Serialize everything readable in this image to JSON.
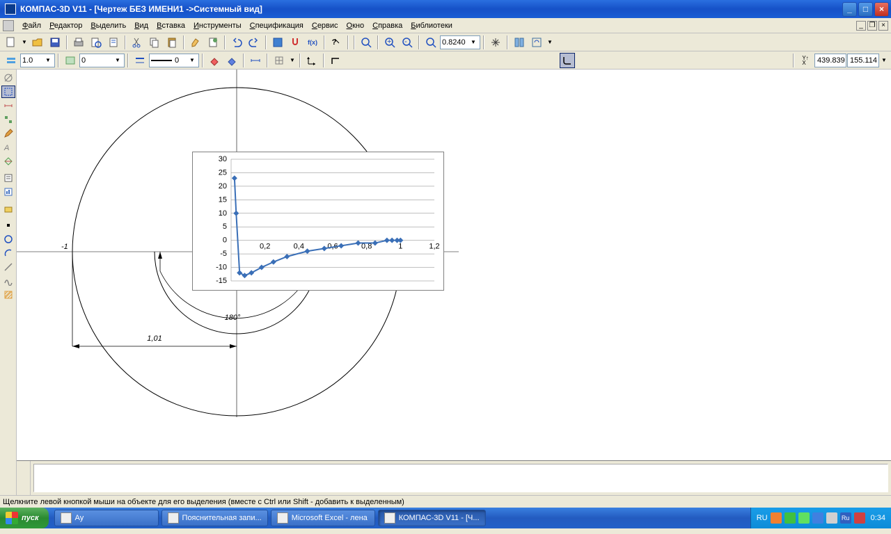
{
  "titlebar": {
    "title": "КОМПАС-3D V11 - [Чертеж БЕЗ ИМЕНИ1 ->Системный вид]"
  },
  "menu": [
    "Файл",
    "Редактор",
    "Выделить",
    "Вид",
    "Вставка",
    "Инструменты",
    "Спецификация",
    "Сервис",
    "Окно",
    "Справка",
    "Библиотеки"
  ],
  "tb1": {
    "zoom": "0.8240"
  },
  "tb2": {
    "scale": "1.0",
    "layer": "0",
    "style": "0",
    "x": "439.839",
    "y": "155.114"
  },
  "drawing": {
    "label_neg1": "-1",
    "angle": "180°",
    "dim": "1,01"
  },
  "chart_data": {
    "type": "line",
    "ylim": [
      -15,
      30
    ],
    "yticks": [
      -15,
      -10,
      -5,
      0,
      5,
      10,
      15,
      20,
      25,
      30
    ],
    "xlim": [
      0,
      1.2
    ],
    "xticks": [
      0.2,
      0.4,
      0.6,
      0.8,
      1,
      1.2
    ],
    "xlabels": [
      "0,2",
      "0,4",
      "0,6",
      "0,8",
      "1",
      "1,2"
    ],
    "series": [
      {
        "name": "",
        "values": [
          {
            "x": 0.02,
            "y": 23
          },
          {
            "x": 0.03,
            "y": 10
          },
          {
            "x": 0.05,
            "y": -12
          },
          {
            "x": 0.08,
            "y": -13
          },
          {
            "x": 0.12,
            "y": -12
          },
          {
            "x": 0.18,
            "y": -10
          },
          {
            "x": 0.25,
            "y": -8
          },
          {
            "x": 0.33,
            "y": -6
          },
          {
            "x": 0.45,
            "y": -4
          },
          {
            "x": 0.55,
            "y": -3
          },
          {
            "x": 0.65,
            "y": -2
          },
          {
            "x": 0.75,
            "y": -1
          },
          {
            "x": 0.85,
            "y": -1
          },
          {
            "x": 0.92,
            "y": 0
          },
          {
            "x": 0.95,
            "y": 0
          },
          {
            "x": 0.98,
            "y": 0
          },
          {
            "x": 1.0,
            "y": 0
          }
        ]
      }
    ]
  },
  "statusbar": {
    "hint": "Щелкните левой кнопкой мыши на объекте для его выделения (вместе с Ctrl или Shift - добавить к выделенным)"
  },
  "taskbar": {
    "start": "пуск",
    "tasks": [
      {
        "label": "Ау",
        "active": false
      },
      {
        "label": "Пояснительная запи...",
        "active": false
      },
      {
        "label": "Microsoft Excel - лена",
        "active": false
      },
      {
        "label": "КОМПАС-3D V11 - [Ч...",
        "active": true
      }
    ],
    "lang": "RU",
    "clock": "0:34"
  }
}
